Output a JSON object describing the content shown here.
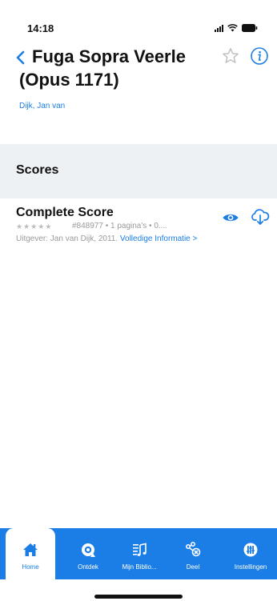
{
  "status": {
    "time": "14:18"
  },
  "header": {
    "title": "Fuga Sopra Veerle (Opus 1171)",
    "composer": "Dijk, Jan van"
  },
  "sections": {
    "scores_title": "Scores"
  },
  "score": {
    "title": "Complete Score",
    "rating_stars": 0,
    "meta": "#848977 • 1 pagina's • 0....",
    "publisher": "Uitgever: Jan van Dijk, 2011. ",
    "more_link": "Volledige Informatie >"
  },
  "tabs": [
    {
      "label": "Home",
      "icon": "home-icon",
      "active": true
    },
    {
      "label": "Ontdek",
      "icon": "discover-icon",
      "active": false
    },
    {
      "label": "Mijn Biblio...",
      "icon": "library-icon",
      "active": false
    },
    {
      "label": "Deel",
      "icon": "share-icon",
      "active": false
    },
    {
      "label": "Instellingen",
      "icon": "settings-icon",
      "active": false
    }
  ],
  "colors": {
    "accent": "#1a7ee6",
    "section_bg": "#eef1f3",
    "muted": "#9a9a9a"
  }
}
